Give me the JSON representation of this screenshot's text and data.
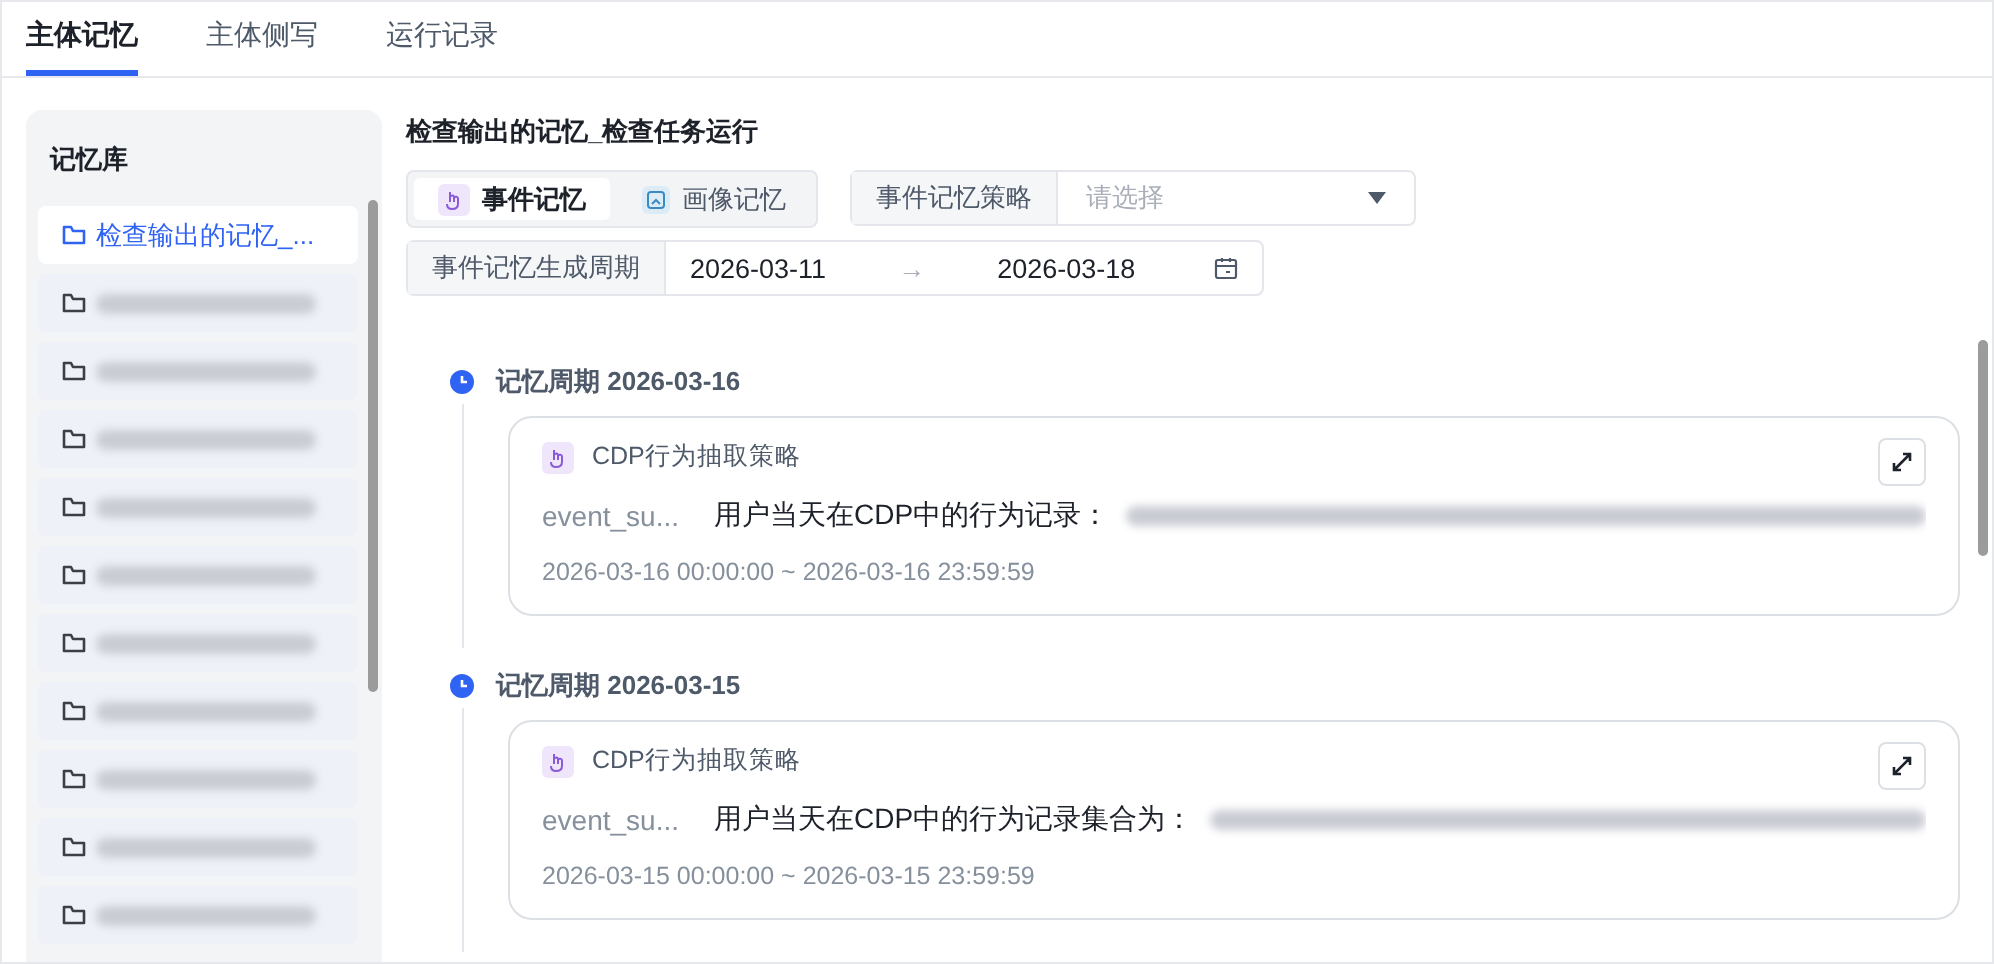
{
  "tabs": [
    {
      "label": "主体记忆",
      "selected": true
    },
    {
      "label": "主体侧写",
      "selected": false
    },
    {
      "label": "运行记录",
      "selected": false
    }
  ],
  "sidebar": {
    "title": "记忆库",
    "items": [
      {
        "kind": "text",
        "label": "检查输出的记忆_...",
        "selected": true
      },
      {
        "kind": "redacted",
        "selected": false
      },
      {
        "kind": "redacted",
        "selected": false
      },
      {
        "kind": "redacted",
        "selected": false
      },
      {
        "kind": "redacted",
        "selected": false
      },
      {
        "kind": "redacted",
        "selected": false
      },
      {
        "kind": "redacted",
        "selected": false
      },
      {
        "kind": "redacted",
        "selected": false
      },
      {
        "kind": "redacted",
        "selected": false
      },
      {
        "kind": "redacted",
        "selected": false
      },
      {
        "kind": "redacted",
        "selected": false
      }
    ]
  },
  "main": {
    "title": "检查输出的记忆_检查任务运行",
    "memory_types": [
      {
        "label": "事件记忆",
        "kind": "event",
        "selected": true
      },
      {
        "label": "画像记忆",
        "kind": "profile",
        "selected": false
      }
    ],
    "strategy": {
      "label": "事件记忆策略",
      "placeholder": "请选择"
    },
    "period": {
      "label": "事件记忆生成周期",
      "start": "2026-03-11",
      "arrow": "→",
      "end": "2026-03-18"
    },
    "timeline": [
      {
        "heading": "记忆周期 2026-03-16",
        "strategy": "CDP行为抽取策略",
        "key": "event_su...",
        "text": "用户当天在CDP中的行为记录：",
        "range": "2026-03-16 00:00:00 ~ 2026-03-16 23:59:59"
      },
      {
        "heading": "记忆周期 2026-03-15",
        "strategy": "CDP行为抽取策略",
        "key": "event_su...",
        "text": "用户当天在CDP中的行为记录集合为：",
        "range": "2026-03-15 00:00:00 ~ 2026-03-15 23:59:59"
      }
    ]
  }
}
